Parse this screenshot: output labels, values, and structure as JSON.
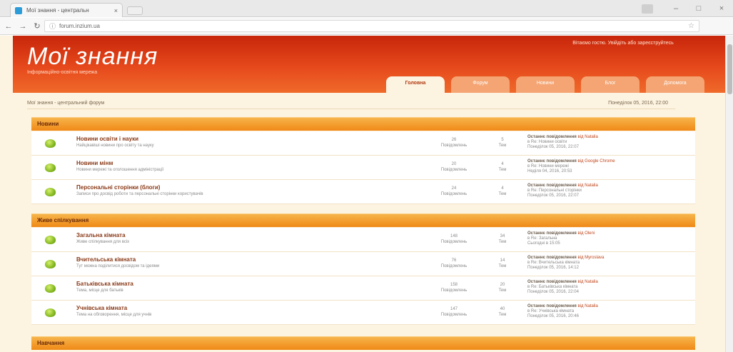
{
  "browser": {
    "tab_title": "Мої знання - центральн",
    "tab_close": "×",
    "url": "forum.inzium.ua",
    "window_controls": [
      "–",
      "□",
      "×"
    ]
  },
  "header": {
    "title": "Мої знання",
    "description": "Інформаційно-освітня мережа",
    "welcome": "Вітаємо гостю. Увійдіть або зареєструйтесь",
    "nav_tabs": [
      "Головна",
      "Форум",
      "Новини",
      "Блог",
      "Допомога"
    ]
  },
  "breadcrumb": "Мої знання - центральний форум",
  "datetime": "Понеділок 05, 2016, 22:00",
  "sections": [
    {
      "title": "Новини",
      "forums": [
        {
          "name": "Новини освіти і науки",
          "desc": "Найцікавіші новини про освіту та науку",
          "posts": "26",
          "posts_label": "Повідомлень",
          "topics": "5",
          "topics_label": "Тем",
          "last_label": "Останнє повідомлення",
          "last_user": "від Natalia",
          "last_topic": "в Re: Новини освіти",
          "last_date": "Понеділок 05, 2016, 22:07"
        },
        {
          "name": "Новини мінм",
          "desc": "Новини мережі та оголошення адміністрації",
          "posts": "20",
          "posts_label": "Повідомлень",
          "topics": "4",
          "topics_label": "Тем",
          "last_label": "Останнє повідомлення",
          "last_user": "від Google Chrome",
          "last_topic": "в Re: Новини мережі",
          "last_date": "Неділя 04, 2016, 20:53"
        },
        {
          "name": "Персональні сторінки (блоги)",
          "desc": "Записи про досвід роботи та персональні сторінки користувачів",
          "posts": "24",
          "posts_label": "Повідомлень",
          "topics": "4",
          "topics_label": "Тем",
          "last_label": "Останнє повідомлення",
          "last_user": "від Natalia",
          "last_topic": "в Re: Персональні сторінки",
          "last_date": "Понеділок 05, 2016, 22:07"
        }
      ]
    },
    {
      "title": "Живе спілкування",
      "forums": [
        {
          "name": "Загальна кімната",
          "desc": "Живе спілкування для всіх",
          "posts": "148",
          "posts_label": "Повідомлень",
          "topics": "34",
          "topics_label": "Тем",
          "last_label": "Останнє повідомлення",
          "last_user": "від Oleni",
          "last_topic": "в Re: Загальна",
          "last_date": "Сьогодні в 15:05"
        },
        {
          "name": "Вчительська кімната",
          "desc": "Тут можна поділитися досвідом та ідеями",
          "posts": "76",
          "posts_label": "Повідомлень",
          "topics": "14",
          "topics_label": "Тем",
          "last_label": "Останнє повідомлення",
          "last_user": "від Myroslava",
          "last_topic": "в Re: Вчительська кімната",
          "last_date": "Понеділок 05, 2016, 14:12"
        },
        {
          "name": "Батьківська кімната",
          "desc": "Тема, місце для батьків",
          "posts": "158",
          "posts_label": "Повідомлень",
          "topics": "20",
          "topics_label": "Тем",
          "last_label": "Останнє повідомлення",
          "last_user": "від Natalia",
          "last_topic": "в Re: Батьківська кімната",
          "last_date": "Понеділок 05, 2016, 22:04"
        },
        {
          "name": "Учнівська кімната",
          "desc": "Тема на обговорення, місце для учнів",
          "posts": "147",
          "posts_label": "Повідомлень",
          "topics": "40",
          "topics_label": "Тем",
          "last_label": "Останнє повідомлення",
          "last_user": "від Natalia",
          "last_topic": "в Re: Учнівська кімната",
          "last_date": "Понеділок 05, 2016, 20:46"
        }
      ]
    },
    {
      "title": "Навчання",
      "forums": []
    }
  ]
}
